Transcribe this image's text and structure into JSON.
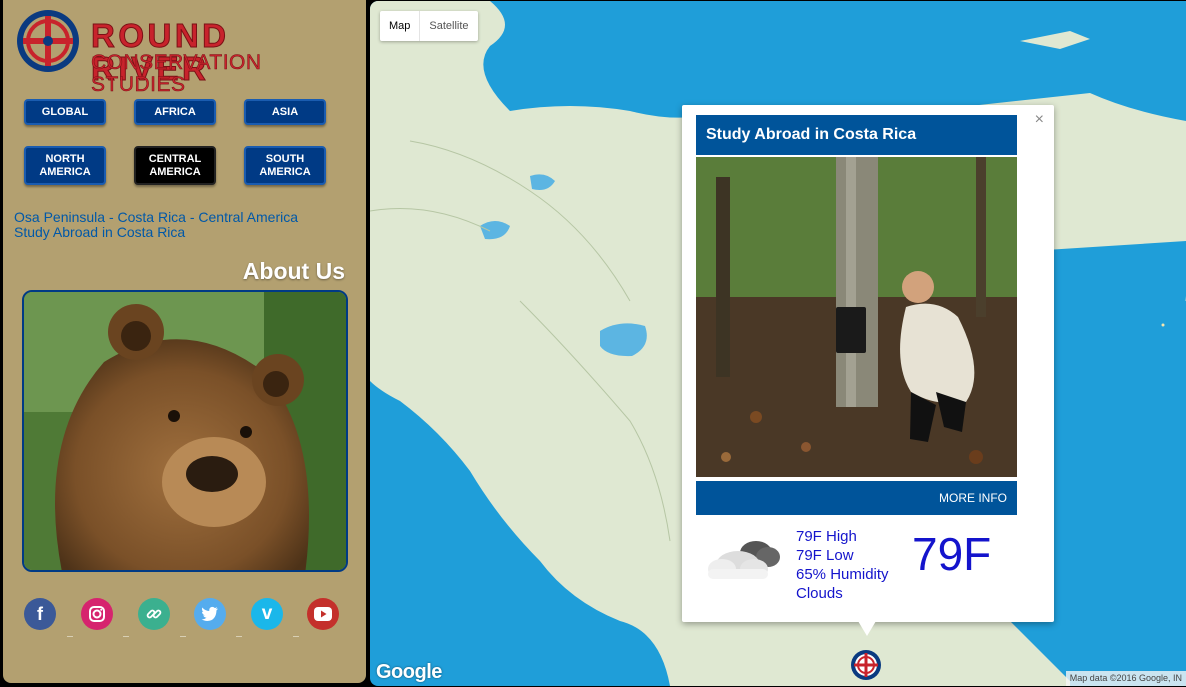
{
  "brand": {
    "line1": "ROUND RIVER",
    "line2": "CONSERVATION STUDIES"
  },
  "regions": [
    {
      "label": "GLOBAL",
      "active": false
    },
    {
      "label": "AFRICA",
      "active": false
    },
    {
      "label": "ASIA",
      "active": false
    },
    {
      "label": "NORTH AMERICA",
      "active": false
    },
    {
      "label": "CENTRAL AMERICA",
      "active": true
    },
    {
      "label": "SOUTH AMERICA",
      "active": false
    }
  ],
  "breadcrumb": {
    "line1": "Osa Peninsula - Costa Rica - Central America",
    "line2": "Study Abroad in Costa Rica"
  },
  "about": {
    "title": "About Us"
  },
  "social": [
    {
      "icon": "facebook-icon",
      "color": "#3b5998"
    },
    {
      "icon": "instagram-icon",
      "color": "#d6246e"
    },
    {
      "icon": "link-icon",
      "color": "#3bb08f"
    },
    {
      "icon": "twitter-icon",
      "color": "#55acee"
    },
    {
      "icon": "vimeo-icon",
      "color": "#1ab7ea"
    },
    {
      "icon": "youtube-icon",
      "color": "#c4302b"
    }
  ],
  "map": {
    "type_map": "Map",
    "type_satellite": "Satellite",
    "google_logo": "Google",
    "attribution": "Map data ©2016 Google, IN",
    "ocean_color": "#1f9ed9",
    "land_color": "#dfe8d2"
  },
  "infowindow": {
    "close": "×",
    "title": "Study Abroad in Costa Rica",
    "more_info": "MORE INFO"
  },
  "weather": {
    "high": "79F High",
    "low": "79F Low",
    "humidity": "65% Humidity",
    "condition": "Clouds",
    "temp": "79F"
  },
  "colors": {
    "accent": "#00549a",
    "brand_red": "#c8232c",
    "sidebar_bg": "#b3a070",
    "weather_text": "#1414cc"
  }
}
